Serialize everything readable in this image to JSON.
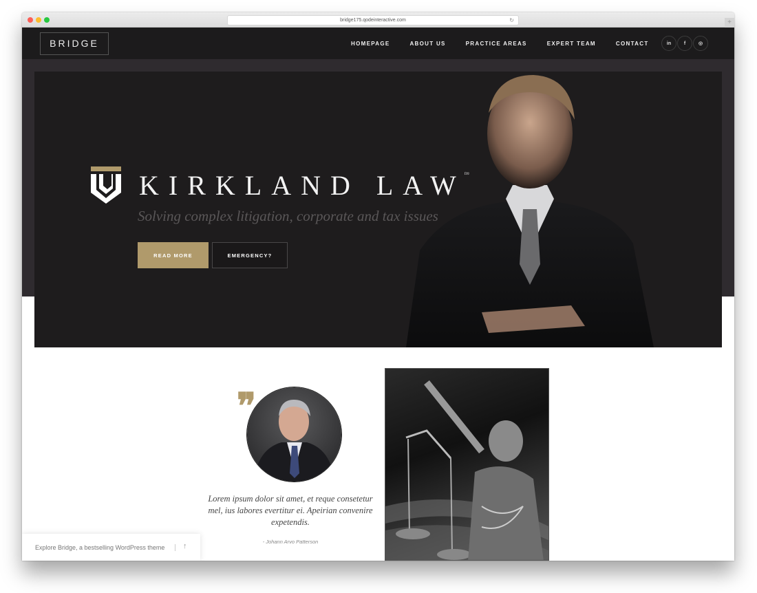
{
  "browser": {
    "url": "bridge175.qodeinteractive.com",
    "reload_icon": "↻",
    "new_tab_icon": "+"
  },
  "header": {
    "logo": "BRIDGE",
    "nav": [
      "HOMEPAGE",
      "ABOUT US",
      "PRACTICE AREAS",
      "EXPERT TEAM",
      "CONTACT"
    ],
    "social": [
      {
        "name": "linkedin-icon",
        "glyph": "in"
      },
      {
        "name": "facebook-icon",
        "glyph": "f"
      },
      {
        "name": "instagram-icon",
        "glyph": "◎"
      }
    ]
  },
  "hero": {
    "brand_name": "KIRKLAND LAW",
    "trademark": "tm",
    "tagline": "Solving complex litigation, corporate and tax issues",
    "buttons": {
      "read_more": "READ MORE",
      "emergency": "EMERGENCY?"
    }
  },
  "testimonial": {
    "quote_mark": "❞",
    "text": "Lorem ipsum dolor sit amet, et reque consetetur mel, ius labores evertitur ei. Apeirian convenire expetendis.",
    "author": "- Johann Arvo Patterson"
  },
  "promo": {
    "text": "Explore Bridge, a bestselling WordPress theme",
    "up_icon": "↑"
  },
  "colors": {
    "accent_gold": "#b09a6b",
    "header_bg": "#1c1b1c",
    "band_bg": "#2f2b2f",
    "hero_bg": "#1e1c1d"
  }
}
